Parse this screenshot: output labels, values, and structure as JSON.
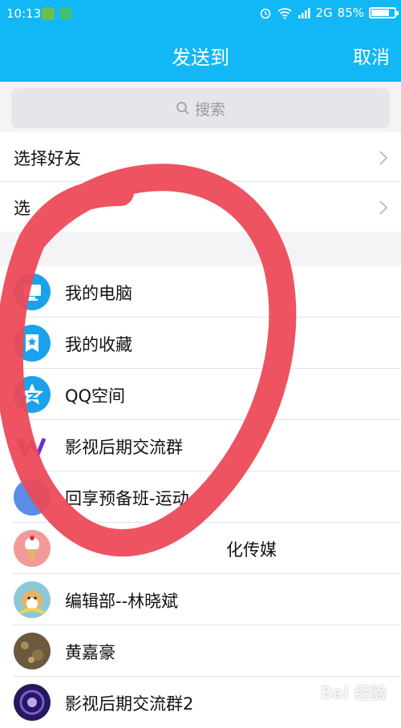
{
  "status_bar": {
    "time": "10:13",
    "network": "2G",
    "battery_percent": "85%",
    "battery_level": 0.85,
    "icons": [
      "wechat-app-icon",
      "scan-app-icon",
      "alarm-icon",
      "wifi-icon",
      "signal-icon",
      "battery-icon"
    ]
  },
  "header": {
    "title": "发送到",
    "cancel_label": "取消",
    "color": "#12b7f5"
  },
  "search": {
    "placeholder": "搜索"
  },
  "nav_rows": [
    {
      "label": "选择好友"
    },
    {
      "label": "选"
    }
  ],
  "contacts": [
    {
      "name": "我的电脑",
      "icon": "computer-icon",
      "color": "#1aa3ec"
    },
    {
      "name": "我的收藏",
      "icon": "favorite-icon",
      "color": "#1aa3ec"
    },
    {
      "name": "QQ空间",
      "icon": "qzone-icon",
      "color": "#1aa3ec"
    },
    {
      "name": "影视后期交流群",
      "icon": "group-avatar"
    },
    {
      "name": "回享预备班-运动",
      "icon": "group-avatar"
    },
    {
      "name": "化传媒",
      "icon": "group-avatar"
    },
    {
      "name": "编辑部--林晓斌",
      "icon": "user-avatar"
    },
    {
      "name": "黄嘉豪",
      "icon": "user-avatar"
    },
    {
      "name": "影视后期交流群2",
      "icon": "group-avatar"
    }
  ],
  "annotation_color": "#ec4a58",
  "watermark": "Bai 经验"
}
